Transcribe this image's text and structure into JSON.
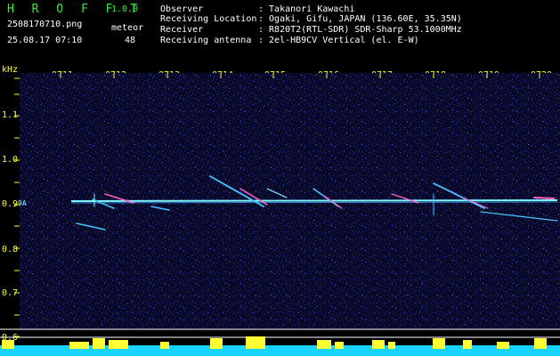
{
  "app": {
    "name": "H R O F F T",
    "version": "1.0.0",
    "filename": "2508170710.png",
    "datetime": "25.08.17 07:10",
    "meteor_label": "meteor",
    "meteor_count": "48"
  },
  "info": {
    "rows": [
      {
        "label": "Observer",
        "value": ": Takanori Kawachi"
      },
      {
        "label": "Receiving Location",
        "value": ": Ogaki, Gifu, JAPAN (136.60E, 35.35N)"
      },
      {
        "label": "Receiver",
        "value": ": R820T2(RTL-SDR) SDR-Sharp 53.1000MHz"
      },
      {
        "label": "Receiving antenna",
        "value": ": 2el-HB9CV Vertical (el. E-W)"
      }
    ]
  },
  "axis": {
    "unit_label": "kHz",
    "time_ticks": [
      "0711",
      "0712",
      "0713",
      "0714",
      "0715",
      "0716",
      "0717",
      "0718",
      "0719",
      "0720"
    ],
    "freq_ticks": [
      "1.1",
      "1.0",
      "0.9",
      "0.8",
      "0.7",
      "0.6"
    ],
    "marker_label": "9A"
  },
  "colors": {
    "background": "#07082a",
    "trace": "#7ffcff",
    "meteor": "#ff66cc",
    "bottom_bar": "#19d3ff",
    "peaks": "#ffff33"
  }
}
